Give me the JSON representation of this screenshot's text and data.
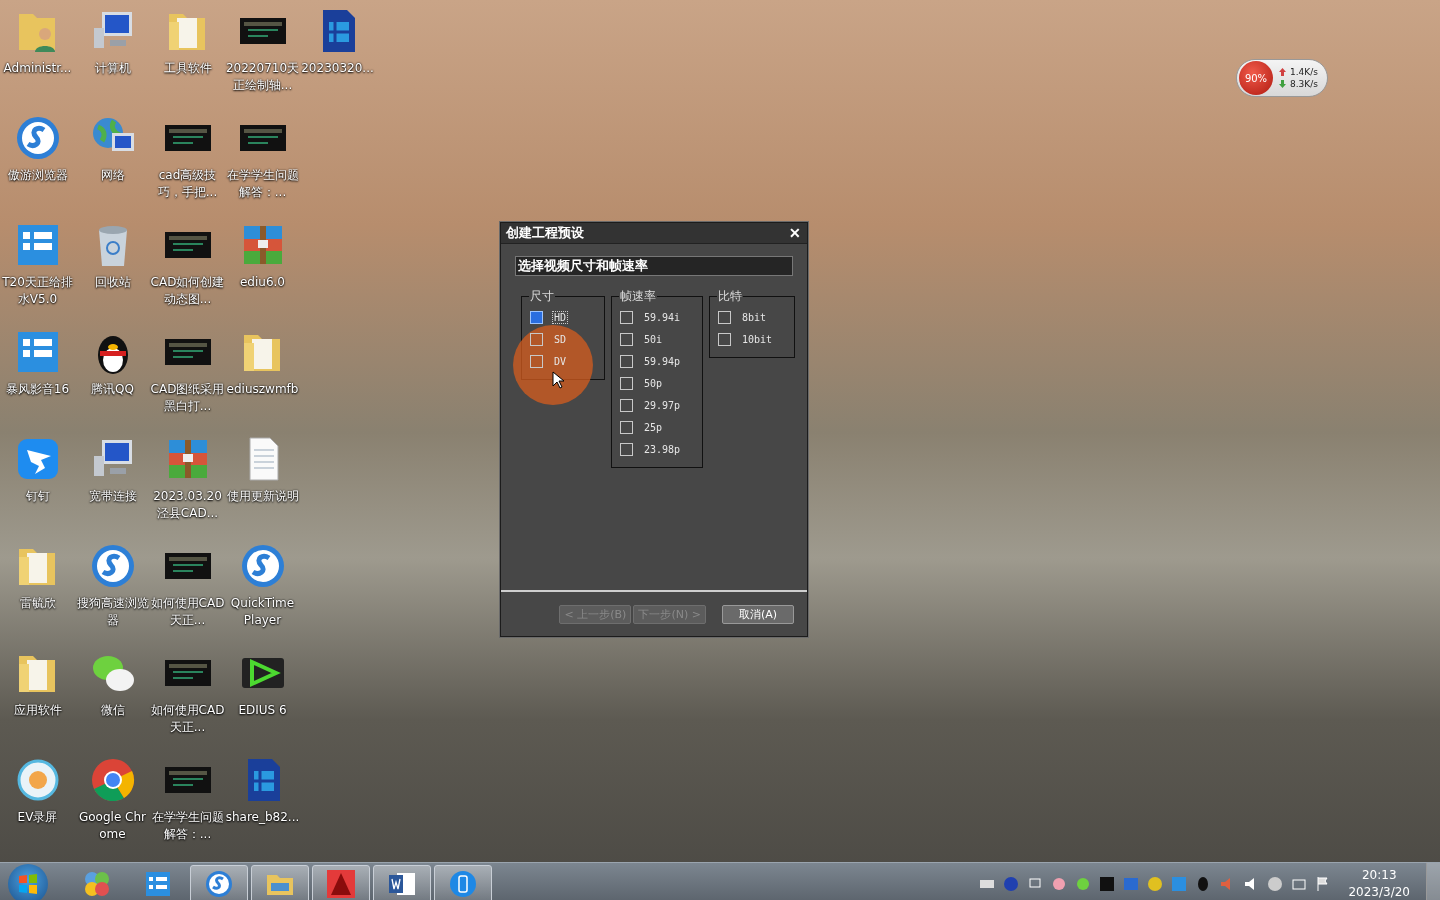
{
  "desktop_icons": [
    {
      "label": "Administr...",
      "kind": "user-folder"
    },
    {
      "label": "计算机",
      "kind": "computer"
    },
    {
      "label": "工具软件",
      "kind": "folder"
    },
    {
      "label": "20220710天正绘制轴...",
      "kind": "video"
    },
    {
      "label": "20230320...",
      "kind": "film-file"
    },
    {
      "label": "傲游浏览器",
      "kind": "round-browser"
    },
    {
      "label": "网络",
      "kind": "network"
    },
    {
      "label": "cad高级技巧，手把...",
      "kind": "video"
    },
    {
      "label": "在学学生问题解答：...",
      "kind": "video"
    },
    {
      "label": "T20天正给排水V5.0",
      "kind": "app-square"
    },
    {
      "label": "回收站",
      "kind": "recycle"
    },
    {
      "label": "CAD如何创建动态图...",
      "kind": "video"
    },
    {
      "label": "ediu6.0",
      "kind": "archive"
    },
    {
      "label": "暴风影音16",
      "kind": "app-square"
    },
    {
      "label": "腾讯QQ",
      "kind": "penguin"
    },
    {
      "label": "CAD图纸采用黑白打...",
      "kind": "video"
    },
    {
      "label": "ediuszwmfb",
      "kind": "folder"
    },
    {
      "label": "钉钉",
      "kind": "wing"
    },
    {
      "label": "宽带连接",
      "kind": "computer"
    },
    {
      "label": "2023.03.20泾县CAD...",
      "kind": "archive"
    },
    {
      "label": "使用更新说明",
      "kind": "document"
    },
    {
      "label": "雷毓欣",
      "kind": "folder"
    },
    {
      "label": "搜狗高速浏览器",
      "kind": "round-browser"
    },
    {
      "label": "如何使用CAD天正...",
      "kind": "video"
    },
    {
      "label": "QuickTime Player",
      "kind": "round-browser"
    },
    {
      "label": "应用软件",
      "kind": "folder"
    },
    {
      "label": "微信",
      "kind": "chat"
    },
    {
      "label": "如何使用CAD天正...",
      "kind": "video"
    },
    {
      "label": "EDIUS 6",
      "kind": "play"
    },
    {
      "label": "EV录屏",
      "kind": "flower"
    },
    {
      "label": "Google Chrome",
      "kind": "chrome"
    },
    {
      "label": "在学学生问题解答：...",
      "kind": "video"
    },
    {
      "label": "share_b82...",
      "kind": "film-file"
    }
  ],
  "net_widget": {
    "usage": "90%",
    "upload": "1.4K/s",
    "download": "8.3K/s"
  },
  "dialog": {
    "title": "创建工程预设",
    "close": "✕",
    "heading": "选择视频尺寸和帧速率",
    "groups": [
      {
        "title": "尺寸",
        "options": [
          {
            "label": "HD",
            "checked": true,
            "focused": true
          },
          {
            "label": "SD",
            "checked": false,
            "focused": false
          },
          {
            "label": "DV",
            "checked": false,
            "focused": false
          }
        ]
      },
      {
        "title": "帧速率",
        "options": [
          {
            "label": "59.94i",
            "checked": false,
            "focused": false
          },
          {
            "label": "50i",
            "checked": false,
            "focused": false
          },
          {
            "label": "59.94p",
            "checked": false,
            "focused": false
          },
          {
            "label": "50p",
            "checked": false,
            "focused": false
          },
          {
            "label": "29.97p",
            "checked": false,
            "focused": false
          },
          {
            "label": "25p",
            "checked": false,
            "focused": false
          },
          {
            "label": "23.98p",
            "checked": false,
            "focused": false
          }
        ]
      },
      {
        "title": "比特",
        "options": [
          {
            "label": "8bit",
            "checked": false,
            "focused": false
          },
          {
            "label": "10bit",
            "checked": false,
            "focused": false
          }
        ]
      }
    ],
    "buttons": [
      {
        "label": "< 上一步(B)",
        "disabled": true
      },
      {
        "label": "下一步(N) >",
        "disabled": true
      },
      {
        "label": "取消(A)",
        "disabled": false
      }
    ]
  },
  "taskbar": {
    "apps": [
      {
        "kind": "colors",
        "open": false
      },
      {
        "kind": "app-square",
        "open": false
      },
      {
        "kind": "round-browser",
        "open": true
      },
      {
        "kind": "explorer",
        "open": true
      },
      {
        "kind": "triangle",
        "open": true
      },
      {
        "kind": "word",
        "open": true
      },
      {
        "kind": "phone",
        "open": true
      }
    ],
    "clock": {
      "time": "20:13",
      "date": "2023/3/20"
    }
  }
}
